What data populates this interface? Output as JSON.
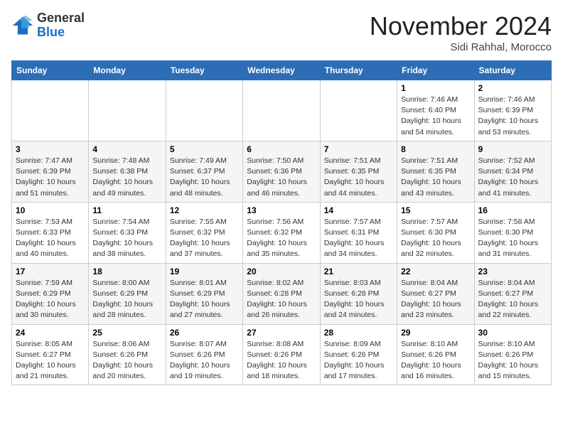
{
  "header": {
    "logo_general": "General",
    "logo_blue": "Blue",
    "month_title": "November 2024",
    "location": "Sidi Rahhal, Morocco"
  },
  "weekdays": [
    "Sunday",
    "Monday",
    "Tuesday",
    "Wednesday",
    "Thursday",
    "Friday",
    "Saturday"
  ],
  "weeks": [
    [
      {
        "day": "",
        "info": ""
      },
      {
        "day": "",
        "info": ""
      },
      {
        "day": "",
        "info": ""
      },
      {
        "day": "",
        "info": ""
      },
      {
        "day": "",
        "info": ""
      },
      {
        "day": "1",
        "info": "Sunrise: 7:46 AM\nSunset: 6:40 PM\nDaylight: 10 hours and 54 minutes."
      },
      {
        "day": "2",
        "info": "Sunrise: 7:46 AM\nSunset: 6:39 PM\nDaylight: 10 hours and 53 minutes."
      }
    ],
    [
      {
        "day": "3",
        "info": "Sunrise: 7:47 AM\nSunset: 6:39 PM\nDaylight: 10 hours and 51 minutes."
      },
      {
        "day": "4",
        "info": "Sunrise: 7:48 AM\nSunset: 6:38 PM\nDaylight: 10 hours and 49 minutes."
      },
      {
        "day": "5",
        "info": "Sunrise: 7:49 AM\nSunset: 6:37 PM\nDaylight: 10 hours and 48 minutes."
      },
      {
        "day": "6",
        "info": "Sunrise: 7:50 AM\nSunset: 6:36 PM\nDaylight: 10 hours and 46 minutes."
      },
      {
        "day": "7",
        "info": "Sunrise: 7:51 AM\nSunset: 6:35 PM\nDaylight: 10 hours and 44 minutes."
      },
      {
        "day": "8",
        "info": "Sunrise: 7:51 AM\nSunset: 6:35 PM\nDaylight: 10 hours and 43 minutes."
      },
      {
        "day": "9",
        "info": "Sunrise: 7:52 AM\nSunset: 6:34 PM\nDaylight: 10 hours and 41 minutes."
      }
    ],
    [
      {
        "day": "10",
        "info": "Sunrise: 7:53 AM\nSunset: 6:33 PM\nDaylight: 10 hours and 40 minutes."
      },
      {
        "day": "11",
        "info": "Sunrise: 7:54 AM\nSunset: 6:33 PM\nDaylight: 10 hours and 38 minutes."
      },
      {
        "day": "12",
        "info": "Sunrise: 7:55 AM\nSunset: 6:32 PM\nDaylight: 10 hours and 37 minutes."
      },
      {
        "day": "13",
        "info": "Sunrise: 7:56 AM\nSunset: 6:32 PM\nDaylight: 10 hours and 35 minutes."
      },
      {
        "day": "14",
        "info": "Sunrise: 7:57 AM\nSunset: 6:31 PM\nDaylight: 10 hours and 34 minutes."
      },
      {
        "day": "15",
        "info": "Sunrise: 7:57 AM\nSunset: 6:30 PM\nDaylight: 10 hours and 32 minutes."
      },
      {
        "day": "16",
        "info": "Sunrise: 7:58 AM\nSunset: 6:30 PM\nDaylight: 10 hours and 31 minutes."
      }
    ],
    [
      {
        "day": "17",
        "info": "Sunrise: 7:59 AM\nSunset: 6:29 PM\nDaylight: 10 hours and 30 minutes."
      },
      {
        "day": "18",
        "info": "Sunrise: 8:00 AM\nSunset: 6:29 PM\nDaylight: 10 hours and 28 minutes."
      },
      {
        "day": "19",
        "info": "Sunrise: 8:01 AM\nSunset: 6:29 PM\nDaylight: 10 hours and 27 minutes."
      },
      {
        "day": "20",
        "info": "Sunrise: 8:02 AM\nSunset: 6:28 PM\nDaylight: 10 hours and 26 minutes."
      },
      {
        "day": "21",
        "info": "Sunrise: 8:03 AM\nSunset: 6:28 PM\nDaylight: 10 hours and 24 minutes."
      },
      {
        "day": "22",
        "info": "Sunrise: 8:04 AM\nSunset: 6:27 PM\nDaylight: 10 hours and 23 minutes."
      },
      {
        "day": "23",
        "info": "Sunrise: 8:04 AM\nSunset: 6:27 PM\nDaylight: 10 hours and 22 minutes."
      }
    ],
    [
      {
        "day": "24",
        "info": "Sunrise: 8:05 AM\nSunset: 6:27 PM\nDaylight: 10 hours and 21 minutes."
      },
      {
        "day": "25",
        "info": "Sunrise: 8:06 AM\nSunset: 6:26 PM\nDaylight: 10 hours and 20 minutes."
      },
      {
        "day": "26",
        "info": "Sunrise: 8:07 AM\nSunset: 6:26 PM\nDaylight: 10 hours and 19 minutes."
      },
      {
        "day": "27",
        "info": "Sunrise: 8:08 AM\nSunset: 6:26 PM\nDaylight: 10 hours and 18 minutes."
      },
      {
        "day": "28",
        "info": "Sunrise: 8:09 AM\nSunset: 6:26 PM\nDaylight: 10 hours and 17 minutes."
      },
      {
        "day": "29",
        "info": "Sunrise: 8:10 AM\nSunset: 6:26 PM\nDaylight: 10 hours and 16 minutes."
      },
      {
        "day": "30",
        "info": "Sunrise: 8:10 AM\nSunset: 6:26 PM\nDaylight: 10 hours and 15 minutes."
      }
    ]
  ]
}
